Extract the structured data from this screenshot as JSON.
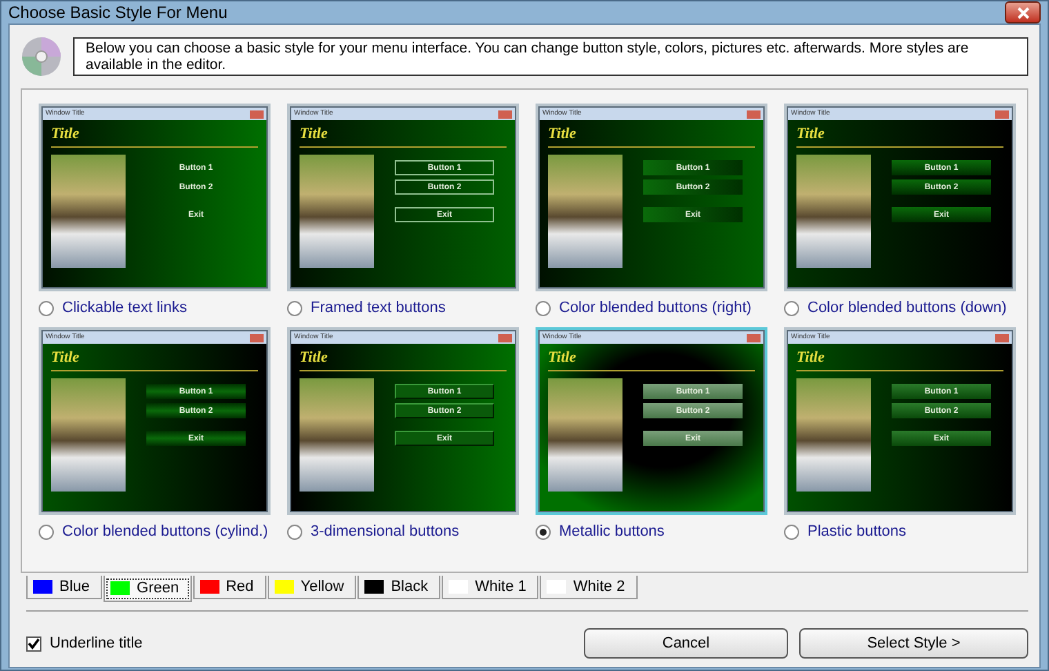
{
  "window": {
    "title": "Choose Basic Style For Menu"
  },
  "intro": "Below you can choose a basic style for your menu interface. You can change button style, colors, pictures etc. afterwards. More styles are available in the editor.",
  "styles": [
    {
      "label": "Clickable text links",
      "kind": "links",
      "selected": false,
      "preview": {
        "window_title": "Window Title",
        "title": "Title",
        "buttons": [
          "Button 1",
          "Button 2",
          "Exit"
        ]
      }
    },
    {
      "label": "Framed text buttons",
      "kind": "framed",
      "selected": false,
      "preview": {
        "window_title": "Window Title",
        "title": "Title",
        "buttons": [
          "Button 1",
          "Button 2",
          "Exit"
        ]
      }
    },
    {
      "label": "Color blended buttons (right)",
      "kind": "blend-right",
      "selected": false,
      "preview": {
        "window_title": "Window Title",
        "title": "Title",
        "buttons": [
          "Button 1",
          "Button 2",
          "Exit"
        ]
      }
    },
    {
      "label": "Color blended buttons (down)",
      "kind": "blend-down",
      "selected": false,
      "preview": {
        "window_title": "Window Title",
        "title": "Title",
        "buttons": [
          "Button 1",
          "Button 2",
          "Exit"
        ]
      }
    },
    {
      "label": "Color blended buttons (cylind.)",
      "kind": "cylinder",
      "selected": false,
      "preview": {
        "window_title": "Window Title",
        "title": "Title",
        "buttons": [
          "Button 1",
          "Button 2",
          "Exit"
        ]
      }
    },
    {
      "label": "3-dimensional buttons",
      "kind": "raised",
      "selected": false,
      "preview": {
        "window_title": "Window Title",
        "title": "Title",
        "buttons": [
          "Button 1",
          "Button 2",
          "Exit"
        ]
      }
    },
    {
      "label": "Metallic buttons",
      "kind": "metallic",
      "selected": true,
      "preview": {
        "window_title": "Window Title",
        "title": "Title",
        "buttons": [
          "Button 1",
          "Button 2",
          "Exit"
        ]
      }
    },
    {
      "label": "Plastic buttons",
      "kind": "plastic",
      "selected": false,
      "preview": {
        "window_title": "Window Title",
        "title": "Title",
        "buttons": [
          "Button 1",
          "Button 2",
          "Exit"
        ]
      }
    }
  ],
  "color_tabs": [
    {
      "label": "Blue",
      "color": "#0000ff",
      "selected": false
    },
    {
      "label": "Green",
      "color": "#00ff00",
      "selected": true
    },
    {
      "label": "Red",
      "color": "#ff0000",
      "selected": false
    },
    {
      "label": "Yellow",
      "color": "#ffff00",
      "selected": false
    },
    {
      "label": "Black",
      "color": "#000000",
      "selected": false
    },
    {
      "label": "White 1",
      "color": "#ffffff",
      "selected": false
    },
    {
      "label": "White 2",
      "color": "#ffffff",
      "selected": false
    }
  ],
  "underline_title": {
    "label": "Underline title",
    "checked": true
  },
  "buttons": [
    "Cancel",
    "Select Style >"
  ]
}
